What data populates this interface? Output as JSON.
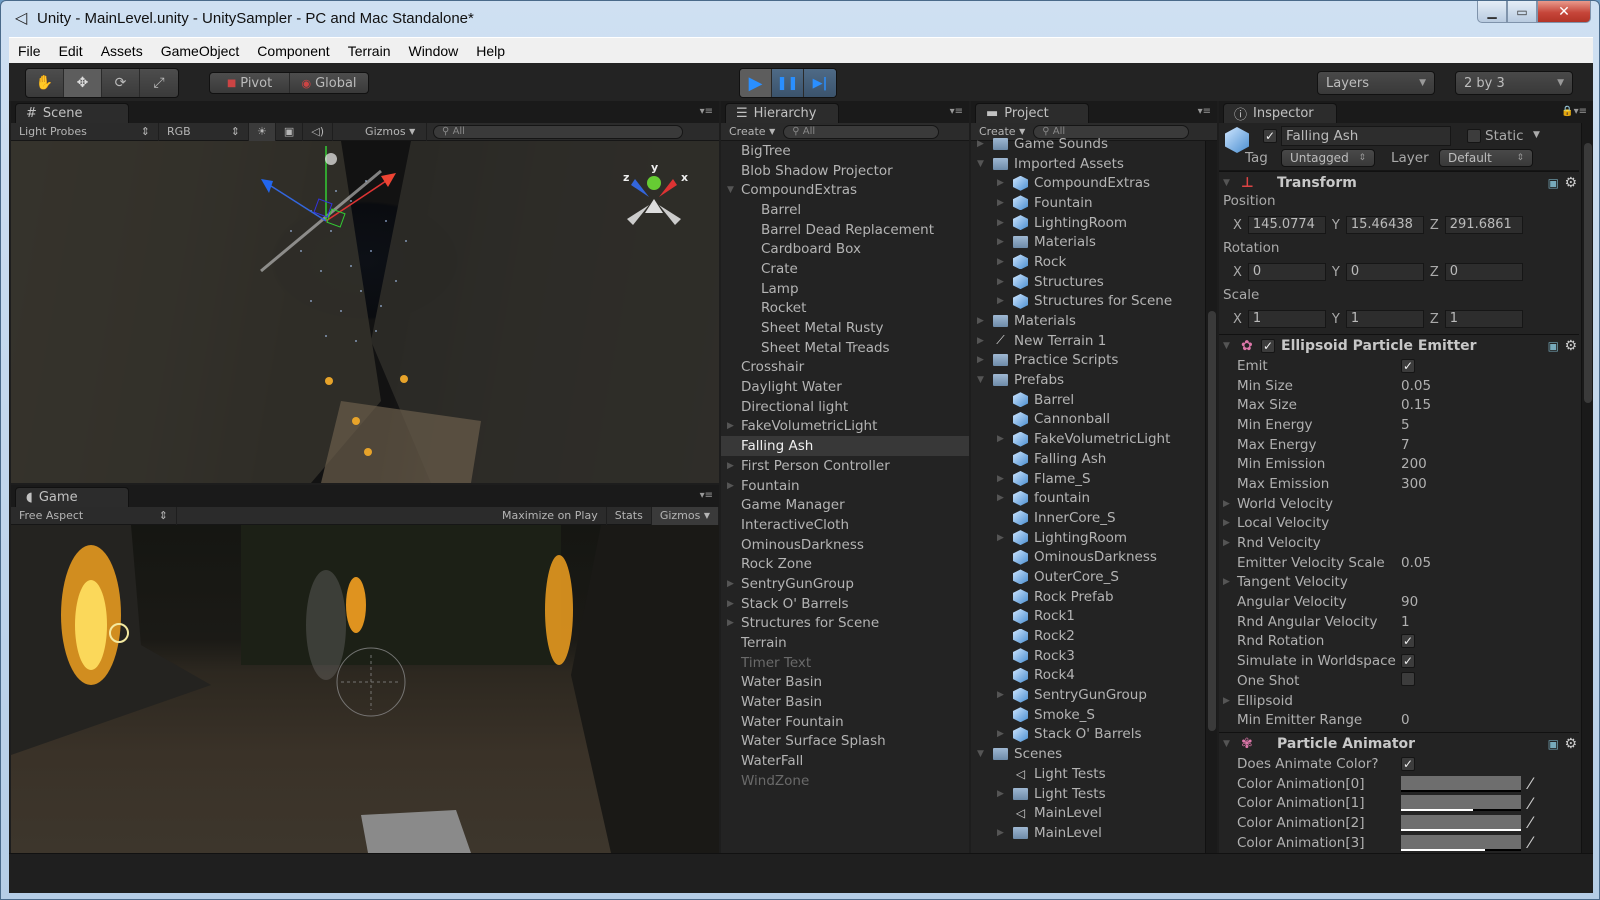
{
  "window": {
    "title": "Unity - MainLevel.unity - UnitySampler - PC and Mac Standalone*",
    "controls": {
      "minimize": "▁",
      "maximize": "▭",
      "close": "✕"
    }
  },
  "menu": [
    "File",
    "Edit",
    "Assets",
    "GameObject",
    "Component",
    "Terrain",
    "Window",
    "Help"
  ],
  "toolbar": {
    "transform_tools": [
      {
        "name": "hand-tool",
        "glyph": "✋",
        "active": false
      },
      {
        "name": "move-tool",
        "glyph": "✥",
        "active": true
      },
      {
        "name": "rotate-tool",
        "glyph": "⟳",
        "active": false
      },
      {
        "name": "scale-tool",
        "glyph": "⤢",
        "active": false
      }
    ],
    "pivot_label": "Pivot",
    "global_label": "Global",
    "play": "▶",
    "pause": "❚❚",
    "step": "▶|",
    "layers_label": "Layers",
    "layout_label": "2 by 3"
  },
  "scene": {
    "tab_label": "Scene",
    "render_mode": "Light Probes",
    "color_mode": "RGB",
    "gizmos_label": "Gizmos",
    "search_placeholder": "All",
    "axis_labels": {
      "x": "x",
      "y": "y",
      "z": "z"
    }
  },
  "game": {
    "tab_label": "Game",
    "aspect": "Free Aspect",
    "maximize_label": "Maximize on Play",
    "stats_label": "Stats",
    "gizmos_label": "Gizmos"
  },
  "hierarchy": {
    "tab_label": "Hierarchy",
    "create_label": "Create",
    "search_placeholder": "All",
    "items": [
      {
        "label": "BigTree",
        "indent": 0,
        "arrow": ""
      },
      {
        "label": "Blob Shadow Projector",
        "indent": 0,
        "arrow": ""
      },
      {
        "label": "CompoundExtras",
        "indent": 0,
        "arrow": "down"
      },
      {
        "label": "Barrel",
        "indent": 1,
        "arrow": ""
      },
      {
        "label": "Barrel Dead Replacement",
        "indent": 1,
        "arrow": ""
      },
      {
        "label": "Cardboard Box",
        "indent": 1,
        "arrow": ""
      },
      {
        "label": "Crate",
        "indent": 1,
        "arrow": ""
      },
      {
        "label": "Lamp",
        "indent": 1,
        "arrow": ""
      },
      {
        "label": "Rocket",
        "indent": 1,
        "arrow": ""
      },
      {
        "label": "Sheet Metal Rusty",
        "indent": 1,
        "arrow": ""
      },
      {
        "label": "Sheet Metal Treads",
        "indent": 1,
        "arrow": ""
      },
      {
        "label": "Crosshair",
        "indent": 0,
        "arrow": ""
      },
      {
        "label": "Daylight Water",
        "indent": 0,
        "arrow": ""
      },
      {
        "label": "Directional light",
        "indent": 0,
        "arrow": ""
      },
      {
        "label": "FakeVolumetricLight",
        "indent": 0,
        "arrow": "right"
      },
      {
        "label": "Falling Ash",
        "indent": 0,
        "arrow": "",
        "selected": true
      },
      {
        "label": "First Person Controller",
        "indent": 0,
        "arrow": "right"
      },
      {
        "label": "Fountain",
        "indent": 0,
        "arrow": "right"
      },
      {
        "label": "Game Manager",
        "indent": 0,
        "arrow": ""
      },
      {
        "label": "InteractiveCloth",
        "indent": 0,
        "arrow": ""
      },
      {
        "label": "OminousDarkness",
        "indent": 0,
        "arrow": ""
      },
      {
        "label": "Rock Zone",
        "indent": 0,
        "arrow": ""
      },
      {
        "label": "SentryGunGroup",
        "indent": 0,
        "arrow": "right"
      },
      {
        "label": "Stack O' Barrels",
        "indent": 0,
        "arrow": "right"
      },
      {
        "label": "Structures for Scene",
        "indent": 0,
        "arrow": "right"
      },
      {
        "label": "Terrain",
        "indent": 0,
        "arrow": ""
      },
      {
        "label": "Timer Text",
        "indent": 0,
        "arrow": "",
        "dim": true
      },
      {
        "label": "Water Basin",
        "indent": 0,
        "arrow": ""
      },
      {
        "label": "Water Basin",
        "indent": 0,
        "arrow": ""
      },
      {
        "label": "Water Fountain",
        "indent": 0,
        "arrow": ""
      },
      {
        "label": "Water Surface Splash",
        "indent": 0,
        "arrow": ""
      },
      {
        "label": "WaterFall",
        "indent": 0,
        "arrow": ""
      },
      {
        "label": "WindZone",
        "indent": 0,
        "arrow": "",
        "dim": true
      }
    ]
  },
  "project": {
    "tab_label": "Project",
    "create_label": "Create",
    "search_placeholder": "All",
    "items": [
      {
        "label": "Game Sounds",
        "indent": 0,
        "arrow": "right",
        "icon": "folder"
      },
      {
        "label": "Imported Assets",
        "indent": 0,
        "arrow": "down",
        "icon": "folder"
      },
      {
        "label": "CompoundExtras",
        "indent": 1,
        "arrow": "right",
        "icon": "model"
      },
      {
        "label": "Fountain",
        "indent": 1,
        "arrow": "right",
        "icon": "model"
      },
      {
        "label": "LightingRoom",
        "indent": 1,
        "arrow": "right",
        "icon": "model"
      },
      {
        "label": "Materials",
        "indent": 1,
        "arrow": "right",
        "icon": "folder"
      },
      {
        "label": "Rock",
        "indent": 1,
        "arrow": "right",
        "icon": "model"
      },
      {
        "label": "Structures",
        "indent": 1,
        "arrow": "right",
        "icon": "model"
      },
      {
        "label": "Structures for Scene",
        "indent": 1,
        "arrow": "right",
        "icon": "prefab"
      },
      {
        "label": "Materials",
        "indent": 0,
        "arrow": "right",
        "icon": "folder"
      },
      {
        "label": "New Terrain 1",
        "indent": 0,
        "arrow": "right",
        "icon": "terrain"
      },
      {
        "label": "Practice Scripts",
        "indent": 0,
        "arrow": "right",
        "icon": "folder"
      },
      {
        "label": "Prefabs",
        "indent": 0,
        "arrow": "down",
        "icon": "folder"
      },
      {
        "label": "Barrel",
        "indent": 1,
        "arrow": "",
        "icon": "prefab"
      },
      {
        "label": "Cannonball",
        "indent": 1,
        "arrow": "",
        "icon": "prefab"
      },
      {
        "label": "FakeVolumetricLight",
        "indent": 1,
        "arrow": "right",
        "icon": "prefab"
      },
      {
        "label": "Falling Ash",
        "indent": 1,
        "arrow": "",
        "icon": "prefab"
      },
      {
        "label": "Flame_S",
        "indent": 1,
        "arrow": "right",
        "icon": "prefab"
      },
      {
        "label": "fountain",
        "indent": 1,
        "arrow": "right",
        "icon": "prefab"
      },
      {
        "label": "InnerCore_S",
        "indent": 1,
        "arrow": "",
        "icon": "prefab"
      },
      {
        "label": "LightingRoom",
        "indent": 1,
        "arrow": "right",
        "icon": "prefab"
      },
      {
        "label": "OminousDarkness",
        "indent": 1,
        "arrow": "",
        "icon": "prefab"
      },
      {
        "label": "OuterCore_S",
        "indent": 1,
        "arrow": "",
        "icon": "prefab"
      },
      {
        "label": "Rock Prefab",
        "indent": 1,
        "arrow": "",
        "icon": "prefab"
      },
      {
        "label": "Rock1",
        "indent": 1,
        "arrow": "",
        "icon": "prefab"
      },
      {
        "label": "Rock2",
        "indent": 1,
        "arrow": "",
        "icon": "prefab"
      },
      {
        "label": "Rock3",
        "indent": 1,
        "arrow": "",
        "icon": "prefab"
      },
      {
        "label": "Rock4",
        "indent": 1,
        "arrow": "",
        "icon": "prefab"
      },
      {
        "label": "SentryGunGroup",
        "indent": 1,
        "arrow": "right",
        "icon": "prefab"
      },
      {
        "label": "Smoke_S",
        "indent": 1,
        "arrow": "",
        "icon": "prefab"
      },
      {
        "label": "Stack O' Barrels",
        "indent": 1,
        "arrow": "right",
        "icon": "prefab"
      },
      {
        "label": "Scenes",
        "indent": 0,
        "arrow": "down",
        "icon": "folder"
      },
      {
        "label": "Light Tests",
        "indent": 1,
        "arrow": "",
        "icon": "scene"
      },
      {
        "label": "Light Tests",
        "indent": 1,
        "arrow": "right",
        "icon": "folder"
      },
      {
        "label": "MainLevel",
        "indent": 1,
        "arrow": "",
        "icon": "scene"
      },
      {
        "label": "MainLevel",
        "indent": 1,
        "arrow": "right",
        "icon": "folder"
      }
    ]
  },
  "inspector": {
    "tab_label": "Inspector",
    "object_name": "Falling Ash",
    "active": true,
    "static_label": "Static",
    "static_checked": false,
    "tag_label": "Tag",
    "tag_value": "Untagged",
    "layer_label": "Layer",
    "layer_value": "Default",
    "transform": {
      "title": "Transform",
      "position_label": "Position",
      "rotation_label": "Rotation",
      "scale_label": "Scale",
      "position": {
        "x": "145.0774",
        "y": "15.46438",
        "z": "291.6861"
      },
      "rotation": {
        "x": "0",
        "y": "0",
        "z": "0"
      },
      "scale": {
        "x": "1",
        "y": "1",
        "z": "1"
      }
    },
    "emitter": {
      "title": "Ellipsoid Particle Emitter",
      "enabled": true,
      "props": [
        {
          "label": "Emit",
          "type": "check",
          "value": true
        },
        {
          "label": "Min Size",
          "type": "text",
          "value": "0.05"
        },
        {
          "label": "Max Size",
          "type": "text",
          "value": "0.15"
        },
        {
          "label": "Min Energy",
          "type": "text",
          "value": "5"
        },
        {
          "label": "Max Energy",
          "type": "text",
          "value": "7"
        },
        {
          "label": "Min Emission",
          "type": "text",
          "value": "200"
        },
        {
          "label": "Max Emission",
          "type": "text",
          "value": "300"
        },
        {
          "label": "World Velocity",
          "type": "foldout"
        },
        {
          "label": "Local Velocity",
          "type": "foldout"
        },
        {
          "label": "Rnd Velocity",
          "type": "foldout"
        },
        {
          "label": "Emitter Velocity Scale",
          "type": "text",
          "value": "0.05"
        },
        {
          "label": "Tangent Velocity",
          "type": "foldout"
        },
        {
          "label": "Angular Velocity",
          "type": "text",
          "value": "90"
        },
        {
          "label": "Rnd Angular Velocity",
          "type": "text",
          "value": "1"
        },
        {
          "label": "Rnd Rotation",
          "type": "check",
          "value": true
        },
        {
          "label": "Simulate in Worldspace",
          "type": "check",
          "value": true
        },
        {
          "label": "One Shot",
          "type": "check",
          "value": false
        },
        {
          "label": "Ellipsoid",
          "type": "foldout"
        },
        {
          "label": "Min Emitter Range",
          "type": "text",
          "value": "0"
        }
      ]
    },
    "animator": {
      "title": "Particle Animator",
      "does_animate_label": "Does Animate Color?",
      "does_animate": true,
      "colors": [
        {
          "label": "Color Animation[0]",
          "alpha": 0.0
        },
        {
          "label": "Color Animation[1]",
          "alpha": 0.6
        },
        {
          "label": "Color Animation[2]",
          "alpha": 1.0
        },
        {
          "label": "Color Animation[3]",
          "alpha": 0.7
        }
      ]
    }
  }
}
